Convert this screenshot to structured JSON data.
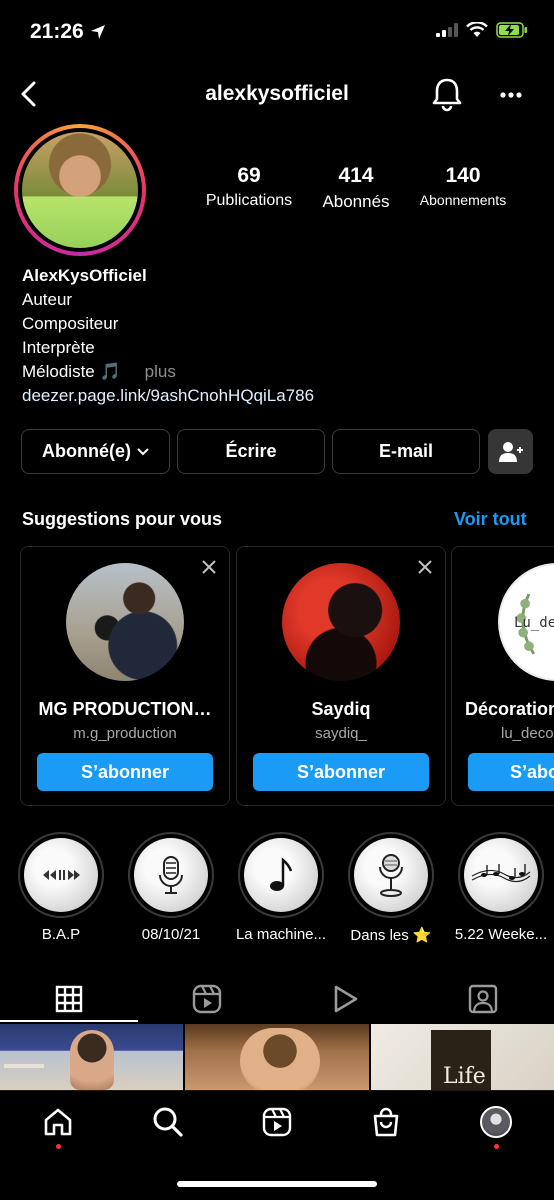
{
  "status_bar": {
    "time": "21:26"
  },
  "header": {
    "username": "alexkysofficiel"
  },
  "stats": [
    {
      "value": "69",
      "label": "Publications"
    },
    {
      "value": "414",
      "label": "Abonnés"
    },
    {
      "value": "140",
      "label": "Abonnements"
    }
  ],
  "bio": {
    "name": "AlexKysOfficiel",
    "lines": [
      "Auteur",
      "Compositeur",
      "Interprète",
      "Mélodiste 🎵"
    ],
    "more": "plus",
    "link": "deezer.page.link/9ashCnohHQqiLa786"
  },
  "actions": {
    "following": "Abonné(e)",
    "message": "Écrire",
    "email": "E-mail"
  },
  "suggestions": {
    "title": "Suggestions pour vous",
    "see_all": "Voir tout",
    "cards": [
      {
        "name": "MG PRODUCTION…",
        "username": "m.g_production",
        "button": "S’abonner"
      },
      {
        "name": "Saydiq",
        "username": "saydiq_",
        "button": "S’abonner"
      },
      {
        "name": "Décoration",
        "username": "lu_deco",
        "button": "S’abo",
        "logo_text": "Lu_dec"
      }
    ]
  },
  "highlights": [
    {
      "label": "B.A.P",
      "icon": "audio-controls-icon"
    },
    {
      "label": "08/10/21",
      "icon": "microphone-icon"
    },
    {
      "label": "La machine...",
      "icon": "music-note-icon"
    },
    {
      "label": "Dans les ⭐",
      "icon": "studio-microphone-icon"
    },
    {
      "label": "5.22 Weeke...",
      "icon": "music-notes-icon"
    }
  ],
  "grid_thumbs": [
    {
      "caption": ""
    },
    {
      "caption": ""
    },
    {
      "caption": "Life"
    }
  ],
  "colors": {
    "accent": "#1a9cf6",
    "notification": "#ff3040",
    "border": "#262626"
  }
}
